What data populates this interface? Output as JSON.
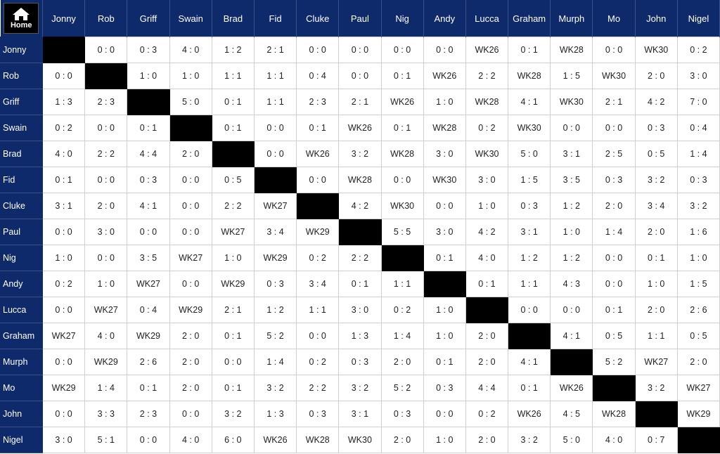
{
  "home": {
    "label": "Home",
    "icon": "home-icon"
  },
  "players": [
    "Jonny",
    "Rob",
    "Griff",
    "Swain",
    "Brad",
    "Fid",
    "Cluke",
    "Paul",
    "Nig",
    "Andy",
    "Lucca",
    "Graham",
    "Murph",
    "Mo",
    "John",
    "Nigel"
  ],
  "results": [
    [
      "",
      "0 : 0",
      "0 : 3",
      "4 : 0",
      "1 : 2",
      "2 : 1",
      "0 : 0",
      "0 : 0",
      "0 : 0",
      "0 : 0",
      "WK26",
      "0 : 1",
      "WK28",
      "0 : 0",
      "WK30",
      "0 : 2"
    ],
    [
      "0 : 0",
      "",
      "1 : 0",
      "1 : 0",
      "1 : 1",
      "1 : 1",
      "0 : 4",
      "0 : 0",
      "0 : 1",
      "WK26",
      "2 : 2",
      "WK28",
      "1 : 5",
      "WK30",
      "2 : 0",
      "3 : 0"
    ],
    [
      "1 : 3",
      "2 : 3",
      "",
      "5 : 0",
      "0 : 1",
      "1 : 1",
      "2 : 3",
      "2 : 1",
      "WK26",
      "1 : 0",
      "WK28",
      "4 : 1",
      "WK30",
      "2 : 1",
      "4 : 2",
      "7 : 0"
    ],
    [
      "0 : 2",
      "0 : 0",
      "0 : 1",
      "",
      "0 : 1",
      "0 : 0",
      "0 : 1",
      "WK26",
      "0 : 1",
      "WK28",
      "0 : 2",
      "WK30",
      "0 : 0",
      "0 : 0",
      "0 : 3",
      "0 : 4"
    ],
    [
      "4 : 0",
      "2 : 2",
      "4 : 4",
      "2 : 0",
      "",
      "0 : 0",
      "WK26",
      "3 : 2",
      "WK28",
      "3 : 0",
      "WK30",
      "5 : 0",
      "3 : 1",
      "2 : 5",
      "0 : 5",
      "1 : 4"
    ],
    [
      "0 : 1",
      "0 : 0",
      "0 : 3",
      "0 : 0",
      "0 : 5",
      "",
      "0 : 0",
      "WK28",
      "0 : 0",
      "WK30",
      "3 : 0",
      "1 : 5",
      "3 : 5",
      "0 : 3",
      "3 : 2",
      "0 : 3"
    ],
    [
      "3 : 1",
      "2 : 0",
      "4 : 1",
      "0 : 0",
      "2 : 2",
      "WK27",
      "",
      "4 : 2",
      "WK30",
      "0 : 0",
      "1 : 0",
      "0 : 3",
      "1 : 2",
      "2 : 0",
      "3 : 4",
      "3 : 2"
    ],
    [
      "0 : 0",
      "3 : 0",
      "0 : 0",
      "0 : 0",
      "WK27",
      "3 : 4",
      "WK29",
      "",
      "5 : 5",
      "3 : 0",
      "4 : 2",
      "3 : 1",
      "1 : 0",
      "1 : 4",
      "2 : 0",
      "1 : 6"
    ],
    [
      "1 : 0",
      "0 : 0",
      "3 : 5",
      "WK27",
      "1 : 0",
      "WK29",
      "0 : 2",
      "2 : 2",
      "",
      "0 : 1",
      "4 : 0",
      "1 : 2",
      "1 : 2",
      "0 : 0",
      "0 : 1",
      "1 : 0"
    ],
    [
      "0 : 2",
      "1 : 0",
      "WK27",
      "0 : 0",
      "WK29",
      "0 : 3",
      "3 : 4",
      "0 : 1",
      "1 : 1",
      "",
      "0 : 1",
      "1 : 1",
      "4 : 3",
      "0 : 0",
      "1 : 0",
      "1 : 5"
    ],
    [
      "0 : 0",
      "WK27",
      "0 : 4",
      "WK29",
      "2 : 1",
      "1 : 2",
      "1 : 1",
      "3 : 0",
      "0 : 2",
      "1 : 0",
      "",
      "0 : 0",
      "0 : 0",
      "0 : 1",
      "2 : 0",
      "2 : 6"
    ],
    [
      "WK27",
      "4 : 0",
      "WK29",
      "2 : 0",
      "0 : 1",
      "5 : 2",
      "0 : 0",
      "1 : 3",
      "1 : 4",
      "1 : 0",
      "2 : 0",
      "",
      "4 : 1",
      "0 : 5",
      "1 : 1",
      "0 : 5"
    ],
    [
      "0 : 0",
      "WK29",
      "2 : 6",
      "2 : 0",
      "0 : 0",
      "1 : 4",
      "0 : 2",
      "0 : 3",
      "2 : 0",
      "0 : 1",
      "2 : 0",
      "4 : 1",
      "",
      "5 : 2",
      "WK27",
      "2 : 0"
    ],
    [
      "WK29",
      "1 : 4",
      "0 : 1",
      "2 : 0",
      "0 : 1",
      "3 : 2",
      "2 : 2",
      "3 : 2",
      "5 : 2",
      "0 : 3",
      "4 : 4",
      "0 : 1",
      "WK26",
      "",
      "3 : 2",
      "WK27"
    ],
    [
      "0 : 0",
      "3 : 3",
      "2 : 3",
      "0 : 0",
      "3 : 2",
      "1 : 3",
      "0 : 3",
      "3 : 1",
      "0 : 3",
      "0 : 0",
      "0 : 2",
      "WK26",
      "4 : 5",
      "WK28",
      "",
      "WK29"
    ],
    [
      "3 : 0",
      "5 : 1",
      "0 : 0",
      "4 : 0",
      "6 : 0",
      "WK26",
      "WK28",
      "WK30",
      "2 : 0",
      "1 : 0",
      "2 : 0",
      "3 : 2",
      "5 : 0",
      "4 : 0",
      "0 : 7",
      ""
    ]
  ],
  "colors": {
    "header_bg": "#0f2a6b",
    "diagonal": "#000000"
  }
}
